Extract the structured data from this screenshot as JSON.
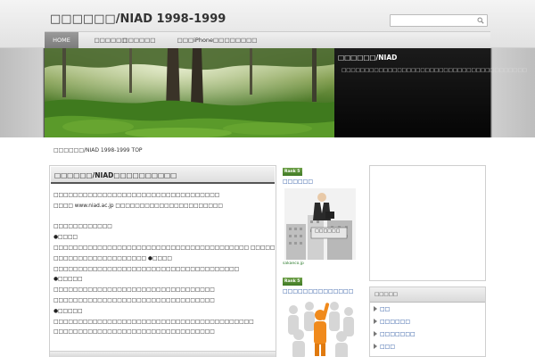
{
  "header": {
    "site_title": "□□□□□□/NIAD 1998-1999",
    "search_placeholder": ""
  },
  "nav": {
    "items": [
      {
        "label": "HOME"
      },
      {
        "label": "□□□□□□"
      },
      {
        "label": "□□□□□□"
      },
      {
        "label": "□□□iPhone□□"
      },
      {
        "label": "□□□□□□"
      }
    ]
  },
  "hero": {
    "heading": "□□□□□□/NIAD",
    "description": "□□□□□□□□□□□□□□□□□□□□□□□□□□□□□□□□□□□□□□□□"
  },
  "breadcrumb": "□□□□□□/NIAD 1998-1999 TOP",
  "main": {
    "title": "□□□□□□/NIAD□□□□□□□□□□",
    "lines": [
      "□□□□□□□□□□□□□□□□□□□□□□□□□□□□□□□□□□",
      "□□□□ www.niad.ac.jp □□□□□□□□□□□□□□□□□□□□□□",
      "",
      "□□□□□□□□□□□□",
      "●□□□□",
      "□□□□□□□□□□□□□□□□□□□□□□□□□□□□□□□□□□□□□□□□ □□□□□□□□□□□□□□□□□□□□□□□□",
      "□□□□□□□□□□□□□□□□□□□ ●□□□□",
      "□□□□□□□□□□□□□□□□□□□□□□□□□□□□□□□□□□□□□□",
      "●□□□□□",
      "□□□□□□□□□□□□□□□□□□□□□□□□□□□□□□□□□",
      "□□□□□□□□□□□□□□□□□□□□□□□□□□□□□□□□□",
      "●□□□□□",
      "□□□□□□□□□□□□□□□□□□□□□□□□□□□□□□□□□□□□□□□□□",
      "□□□□□□□□□□□□□□□□□□□□□□□□□□□□□□□□□"
    ]
  },
  "middle": {
    "ads": [
      {
        "badge": "Rank 5",
        "link": "□□□□□□",
        "site": "sakaeco.jp",
        "sign": "□□□□□□"
      },
      {
        "badge": "Rank 5",
        "link": "□□□□□□□□□□□□□□",
        "site": "",
        "sign": ""
      }
    ]
  },
  "sidebar": {
    "panel_title": "□□□□□",
    "items": [
      {
        "label": "□□"
      },
      {
        "label": "□□□□□□"
      },
      {
        "label": "□□□□□□□"
      },
      {
        "label": "□□□"
      }
    ]
  },
  "colors": {
    "nav_active": "#8a8a8a",
    "link": "#1a4a9a",
    "hero_panel": "#111111"
  }
}
